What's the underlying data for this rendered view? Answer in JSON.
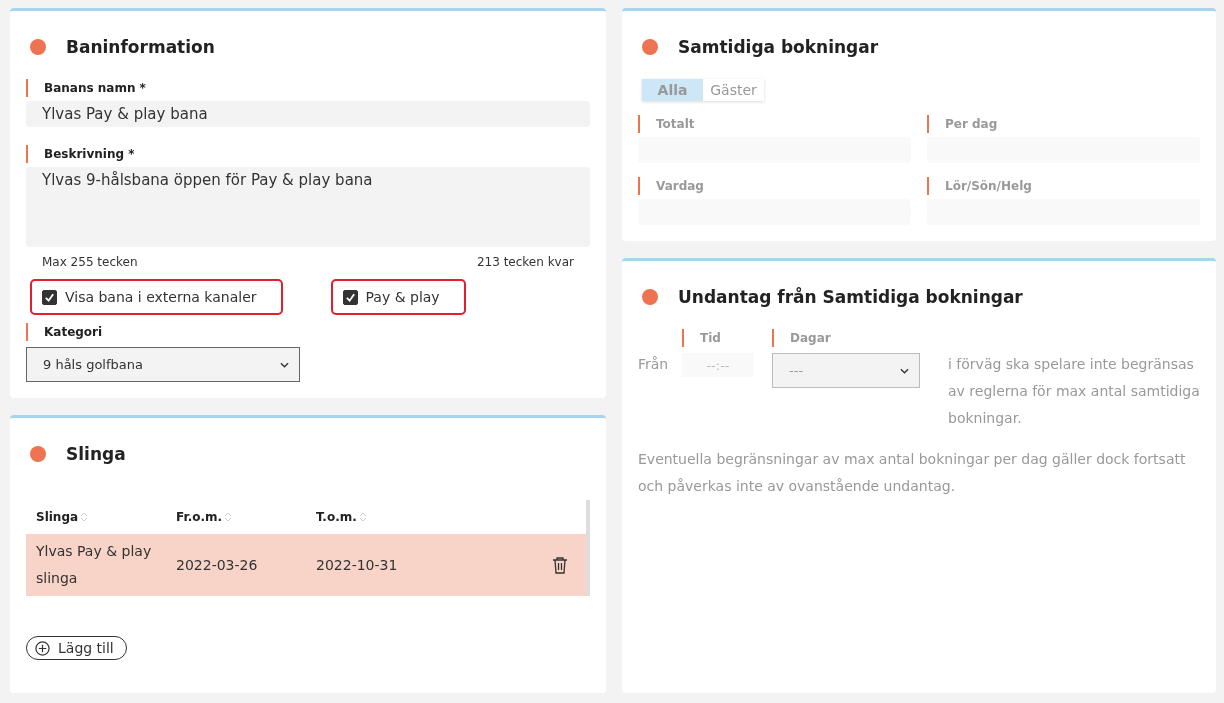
{
  "course_info": {
    "title": "Baninformation",
    "name_field": {
      "label": "Banans namn *",
      "value": "Ylvas Pay & play bana"
    },
    "description_field": {
      "label": "Beskrivning *",
      "value": "Ylvas 9-hålsbana öppen för Pay & play bana",
      "max_hint": "Max 255 tecken",
      "remaining_hint": "213 tecken kvar"
    },
    "checkboxes": [
      {
        "label": "Visa bana i externa kanaler",
        "checked": true
      },
      {
        "label": "Pay & play",
        "checked": true
      }
    ],
    "category": {
      "label": "Kategori",
      "value": "9 håls golfbana"
    }
  },
  "loop": {
    "title": "Slinga",
    "columns": [
      "Slinga",
      "Fr.o.m.",
      "T.o.m."
    ],
    "rows": [
      {
        "cells": [
          "Ylvas Pay & play slinga",
          "2022-03-26",
          "2022-10-31"
        ],
        "selected": true
      }
    ],
    "add_button": "Lägg till"
  },
  "concurrent_bookings": {
    "title": "Samtidiga bokningar",
    "disabled": true,
    "tabs": [
      {
        "label": "Alla",
        "selected": true
      },
      {
        "label": "Gäster",
        "selected": false
      }
    ],
    "fields": [
      {
        "label": "Totalt"
      },
      {
        "label": "Per dag"
      },
      {
        "label": "Vardag"
      },
      {
        "label": "Lör/Sön/Helg"
      }
    ]
  },
  "exceptions": {
    "title": "Undantag från Samtidiga bokningar",
    "disabled": true,
    "from_label": "Från",
    "time_label": "Tid",
    "time_placeholder": "--:--",
    "days_label": "Dagar",
    "days_value": "---",
    "sentence": "i förväg ska spelare inte begränsas av reglerna för max antal samtidiga bokningar.",
    "note": "Eventuella begränsningar av max antal bokningar per dag gäller dock fortsatt och påverkas inte av ovanstående undantag."
  }
}
